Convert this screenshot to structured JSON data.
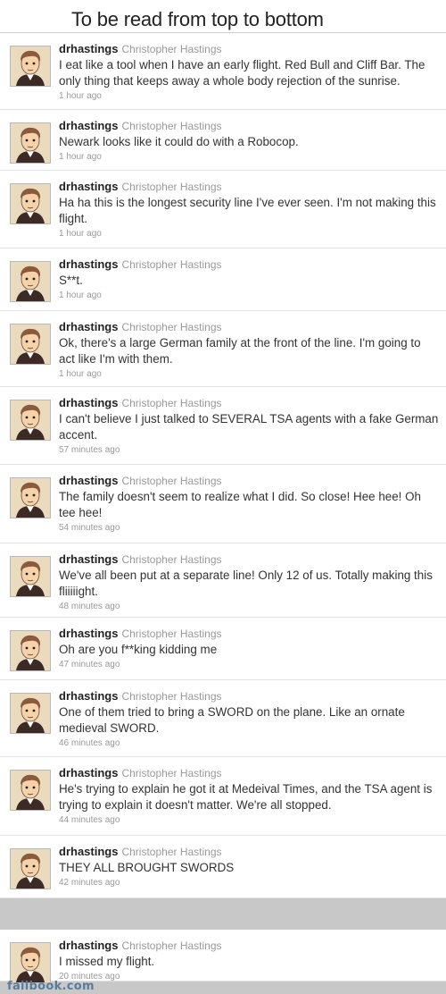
{
  "header": {
    "title": "To be read from top to bottom"
  },
  "user": {
    "handle": "drhastings",
    "fullname": "Christopher Hastings"
  },
  "tweets": [
    {
      "text": "I eat like a tool when I have an early flight. Red Bull and Cliff Bar. The only thing that keeps away a whole body rejection of the sunrise.",
      "time": "1 hour ago"
    },
    {
      "text": "Newark looks like it could do with a Robocop.",
      "time": "1 hour ago"
    },
    {
      "text": "Ha ha this is the longest security line I've ever seen. I'm not making this flight.",
      "time": "1 hour ago"
    },
    {
      "text": "S**t.",
      "time": "1 hour ago"
    },
    {
      "text": "Ok, there's a large German family at the front of the line. I'm going to act like I'm with them.",
      "time": "1 hour ago"
    },
    {
      "text": "I can't believe I just talked to SEVERAL TSA agents with a fake German accent.",
      "time": "57 minutes ago"
    },
    {
      "text": "The family doesn't seem to realize what I did. So close! Hee hee! Oh tee hee!",
      "time": "54 minutes ago"
    },
    {
      "text": "We've all been put at a separate line! Only 12 of us. Totally making this fliiiiight.",
      "time": "48 minutes ago"
    },
    {
      "text": "Oh are you f**king kidding me",
      "time": "47 minutes ago"
    },
    {
      "text": "One of them tried to bring a SWORD on the plane. Like an ornate medieval SWORD.",
      "time": "46 minutes ago"
    },
    {
      "text": "He's trying to explain he got it at Medeival Times, and the TSA agent is trying to explain it doesn't matter. We're all stopped.",
      "time": "44 minutes ago"
    },
    {
      "text": "THEY ALL BROUGHT SWORDS",
      "time": "42 minutes ago"
    },
    {
      "text": "I missed my flight.",
      "time": "20 minutes ago"
    }
  ],
  "footer": {
    "logo": "failbook.com"
  },
  "colors": {
    "banner_bg": "#ffffff",
    "page_bg": "#c8c8c8",
    "handle": "#222222",
    "meta": "#999999"
  }
}
